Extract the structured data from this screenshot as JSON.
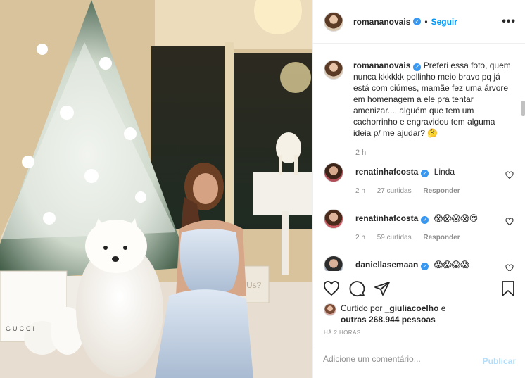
{
  "post": {
    "author": "romananovais",
    "follow_label": "Seguir",
    "more_label": "•••",
    "caption_author": "romananovais",
    "caption_text": "Preferi essa foto, quem nunca kkkkkk pollinho meio bravo pq já está com ciúmes, mamãe fez uma árvore em homenagem a ele pra tentar amenizar.... alguém que tem um cachorrinho e engravidou tem alguma ideia p/ me ajudar? 🤔",
    "caption_time": "2 h"
  },
  "comments": [
    {
      "user": "renatinhafcosta",
      "text": "Linda",
      "time": "2 h",
      "likes": "27 curtidas",
      "reply": "Responder"
    },
    {
      "user": "renatinhafcosta",
      "text": "😱😱😱😱😍",
      "time": "2 h",
      "likes": "59 curtidas",
      "reply": "Responder"
    },
    {
      "user": "daniellasemaan",
      "text": "😱😱😱😱"
    }
  ],
  "likes": {
    "prefix": "Curtido por",
    "user": "_giuliacoelho",
    "suffix": "e",
    "others": "outras 268.944 pessoas"
  },
  "posted_ago": "HÁ 2 HORAS",
  "add_comment": {
    "placeholder": "Adicione um comentário...",
    "publish_label": "Publicar"
  },
  "photo_text": {
    "bag_brand": "GUCCI",
    "bag_text": "Us?"
  },
  "colors": {
    "accent": "#0095f6",
    "muted": "#8e8e8e",
    "publish_disabled": "#b2dffc"
  },
  "icons": [
    "heart-icon",
    "comment-icon",
    "share-icon",
    "bookmark-icon",
    "verified-icon",
    "more-icon"
  ]
}
